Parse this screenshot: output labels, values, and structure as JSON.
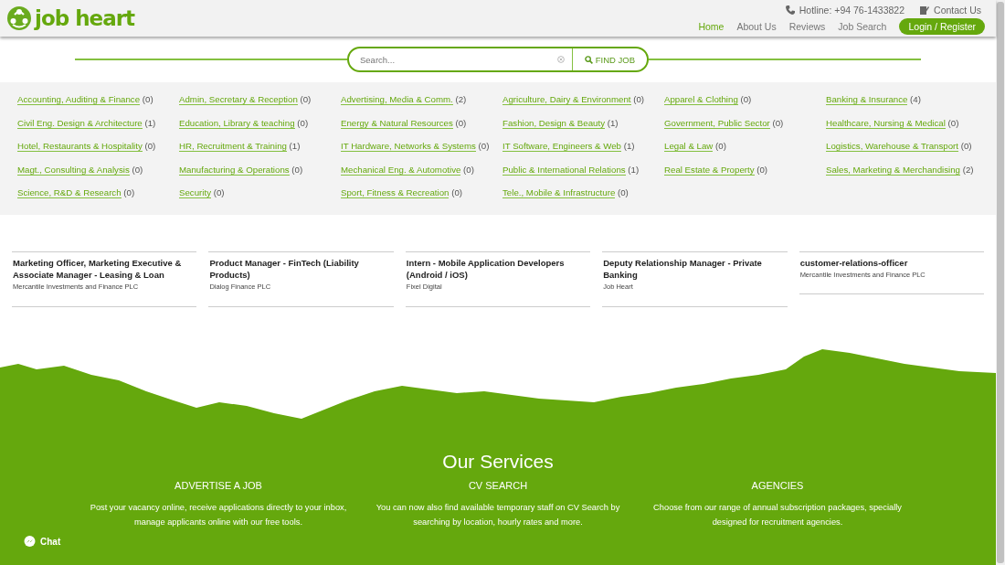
{
  "header": {
    "logo_text": "job heart",
    "hotline": "Hotline: +94 76-1433822",
    "contact": "Contact Us",
    "nav": [
      {
        "label": "Home",
        "selected": true
      },
      {
        "label": "About Us",
        "selected": false
      },
      {
        "label": "Reviews",
        "selected": false
      },
      {
        "label": "Job Search",
        "selected": false
      }
    ],
    "login": "Login / Register"
  },
  "search": {
    "placeholder": "Search...",
    "button": "FIND JOB"
  },
  "categories": [
    {
      "name": "Accounting, Auditing & Finance",
      "count": "(0)"
    },
    {
      "name": "Admin, Secretary & Reception",
      "count": "(0)"
    },
    {
      "name": "Advertising, Media & Comm.",
      "count": "(2)"
    },
    {
      "name": "Agriculture, Dairy & Environment",
      "count": "(0)"
    },
    {
      "name": "Apparel & Clothing",
      "count": "(0)"
    },
    {
      "name": "Banking & Insurance",
      "count": "(4)"
    },
    {
      "name": "Civil Eng. Design & Architecture",
      "count": "(1)"
    },
    {
      "name": "Education, Library & teaching",
      "count": "(0)"
    },
    {
      "name": "Energy & Natural Resources",
      "count": "(0)"
    },
    {
      "name": "Fashion, Design & Beauty",
      "count": "(1)"
    },
    {
      "name": "Government, Public Sector",
      "count": "(0)"
    },
    {
      "name": "Healthcare, Nursing & Medical",
      "count": "(0)"
    },
    {
      "name": "Hotel, Restaurants & Hospitality",
      "count": "(0)"
    },
    {
      "name": "HR, Recruitment & Training",
      "count": "(1)"
    },
    {
      "name": "IT Hardware, Networks & Systems",
      "count": "(0)"
    },
    {
      "name": "IT Software, Engineers & Web",
      "count": "(1)"
    },
    {
      "name": "Legal & Law",
      "count": "(0)"
    },
    {
      "name": "Logistics, Warehouse & Transport",
      "count": "(0)"
    },
    {
      "name": "Magt., Consulting & Analysis",
      "count": "(0)"
    },
    {
      "name": "Manufacturing & Operations",
      "count": "(0)"
    },
    {
      "name": "Mechanical Eng. & Automotive",
      "count": "(0)"
    },
    {
      "name": "Public & International Relations",
      "count": "(1)"
    },
    {
      "name": "Real Estate & Property",
      "count": "(0)"
    },
    {
      "name": "Sales, Marketing & Merchandising",
      "count": "(2)"
    },
    {
      "name": "Science, R&D & Research",
      "count": "(0)"
    },
    {
      "name": "Security",
      "count": "(0)"
    },
    {
      "name": "Sport, Fitness & Recreation",
      "count": "(0)"
    },
    {
      "name": "Tele., Mobile & Infrastructure",
      "count": "(0)"
    }
  ],
  "jobs": [
    {
      "title": "Marketing Officer, Marketing Executive & Associate Manager - Leasing & Loan",
      "company": "Mercantile Investments and Finance PLC"
    },
    {
      "title": "Product Manager - FinTech (Liability Products)",
      "company": "Dialog Finance PLC"
    },
    {
      "title": "Intern - Mobile Application Developers (Android / iOS)",
      "company": "Fixel Digital"
    },
    {
      "title": "Deputy Relationship Manager - Private Banking",
      "company": "Job Heart"
    },
    {
      "title": "customer-relations-officer",
      "company": "Mercantile Investments and Finance PLC"
    }
  ],
  "services": {
    "title": "Our Services",
    "items": [
      {
        "heading": "ADVERTISE A JOB",
        "text": "Post your vacancy online, receive applications directly to your inbox, manage applicants online with our free tools."
      },
      {
        "heading": "CV SEARCH",
        "text": "You can now also find available temporary staff on CV Search by searching by location, hourly rates and more."
      },
      {
        "heading": "AGENCIES",
        "text": "Choose from our range of annual subscription packages, specially designed for recruitment agencies."
      }
    ]
  },
  "chat": "Chat"
}
